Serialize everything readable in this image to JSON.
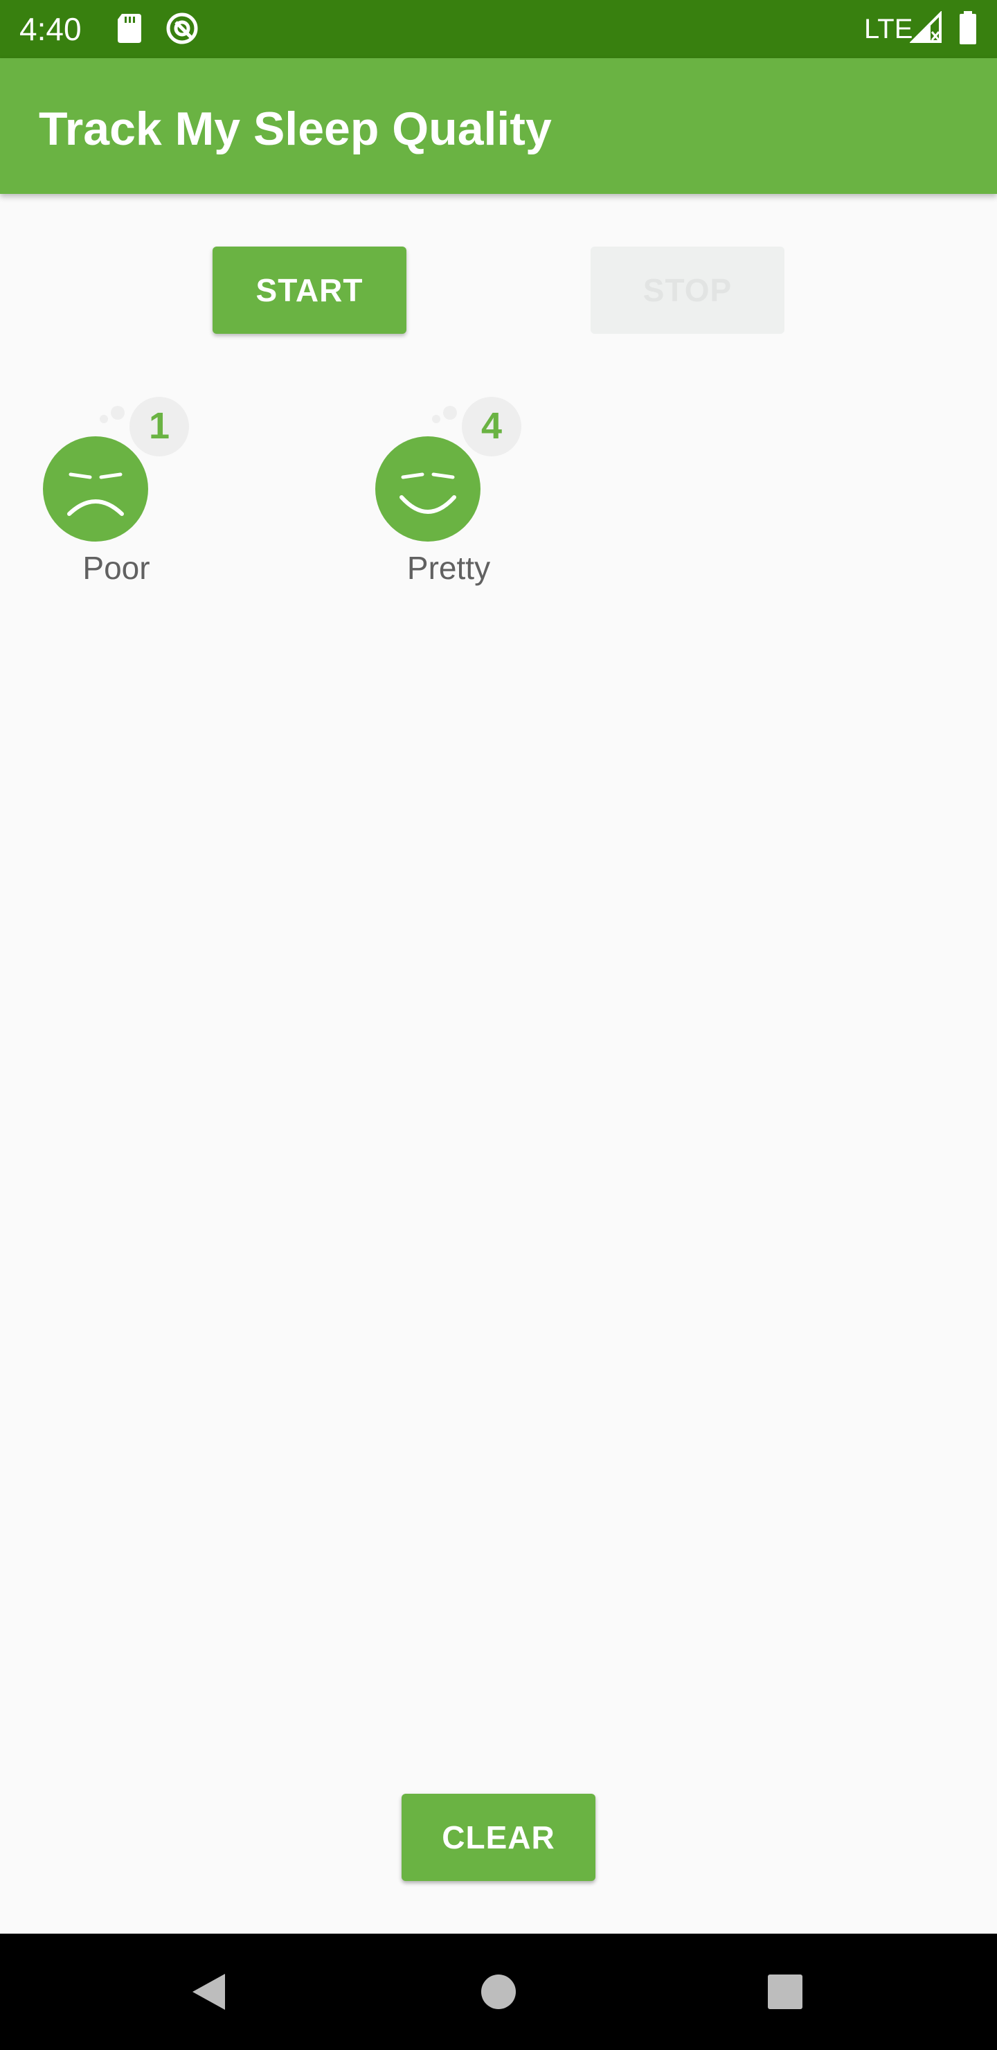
{
  "status_bar": {
    "time": "4:40",
    "network": "LTE",
    "icons": [
      "sd-card-icon",
      "do-not-disturb-icon",
      "signal-icon",
      "battery-icon"
    ]
  },
  "app_bar": {
    "title": "Track My Sleep Quality"
  },
  "buttons": {
    "start": "START",
    "stop": "STOP",
    "clear": "CLEAR"
  },
  "sleep_nights": [
    {
      "rating": "1",
      "label": "Poor",
      "face": "sad"
    },
    {
      "rating": "4",
      "label": "Pretty",
      "face": "happy"
    }
  ],
  "colors": {
    "status_bar": "#38800f",
    "primary": "#6ab343",
    "background": "#fafafa",
    "disabled": "#eef0ef",
    "label": "#616161"
  },
  "nav_bar": {
    "icons": [
      "back-icon",
      "home-icon",
      "recents-icon"
    ]
  }
}
